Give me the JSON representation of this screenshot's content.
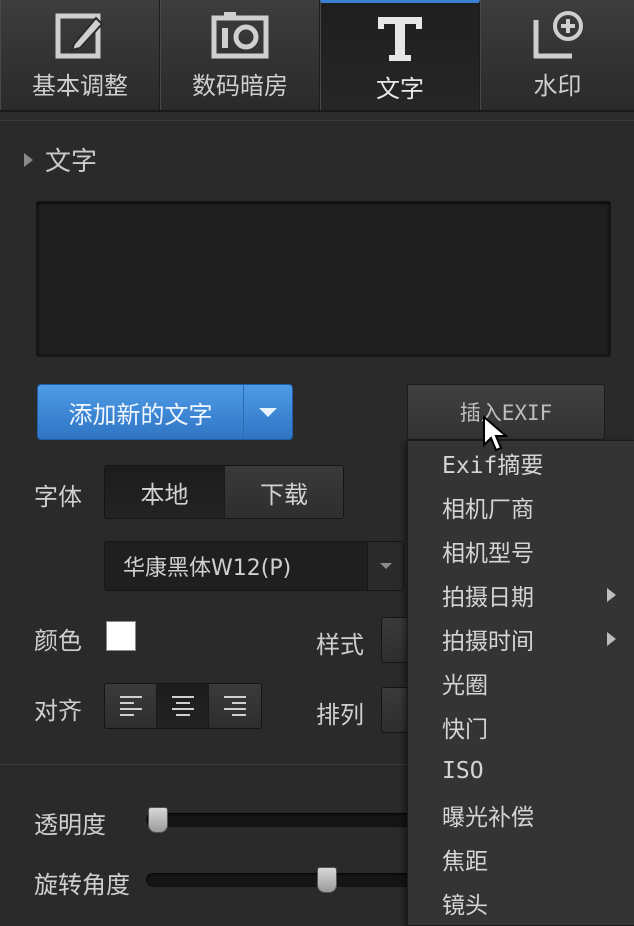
{
  "tabs": [
    {
      "label": "基本调整",
      "icon": "edit-icon"
    },
    {
      "label": "数码暗房",
      "icon": "camera-icon"
    },
    {
      "label": "文字",
      "icon": "text-icon",
      "active": true
    },
    {
      "label": "水印",
      "icon": "add-watermark-icon"
    }
  ],
  "section": {
    "title": "文字"
  },
  "add_text_button": "添加新的文字",
  "insert_exif_button": "插入EXIF",
  "font": {
    "label": "字体",
    "source_options": [
      "本地",
      "下载"
    ],
    "selected_source": "本地",
    "selected_font": "华康黑体W12(P)"
  },
  "color": {
    "label": "颜色",
    "value": "#ffffff"
  },
  "style": {
    "label": "样式"
  },
  "align": {
    "label": "对齐",
    "options": [
      "left",
      "center",
      "right"
    ],
    "selected": "center"
  },
  "arrange": {
    "label": "排列"
  },
  "opacity": {
    "label": "透明度",
    "value": 0
  },
  "rotation": {
    "label": "旋转角度",
    "value": 0.5
  },
  "exif_menu": [
    {
      "label": "Exif摘要",
      "submenu": false,
      "mono": false
    },
    {
      "label": "相机厂商",
      "submenu": false
    },
    {
      "label": "相机型号",
      "submenu": false
    },
    {
      "label": "拍摄日期",
      "submenu": true
    },
    {
      "label": "拍摄时间",
      "submenu": true
    },
    {
      "label": "光圈",
      "submenu": false
    },
    {
      "label": "快门",
      "submenu": false
    },
    {
      "label": "ISO",
      "submenu": false,
      "mono": true
    },
    {
      "label": "曝光补偿",
      "submenu": false
    },
    {
      "label": "焦距",
      "submenu": false
    },
    {
      "label": "镜头",
      "submenu": false
    }
  ]
}
